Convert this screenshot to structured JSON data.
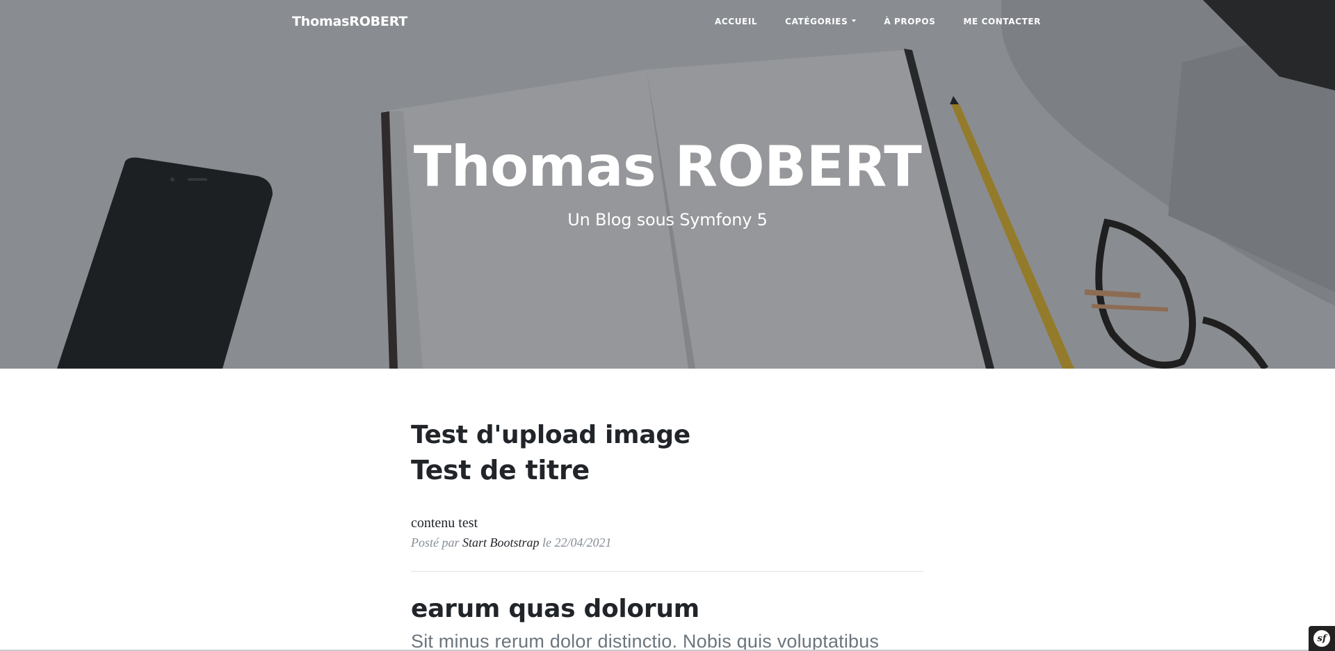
{
  "navbar": {
    "brand": "ThomasROBERT",
    "links": [
      {
        "label": "Accueil"
      },
      {
        "label": "Catégories",
        "dropdown": true
      },
      {
        "label": "À propos"
      },
      {
        "label": "Me contacter"
      }
    ]
  },
  "hero": {
    "title": "Thomas ROBERT",
    "subtitle": "Un Blog sous Symfony 5"
  },
  "posts": [
    {
      "title": "Test d'upload image",
      "subtitle": "Test de titre",
      "excerpt": "contenu test",
      "meta_prefix": "Posté par",
      "author": "Start Bootstrap",
      "meta_date_prefix": "le",
      "date": "22/04/2021"
    },
    {
      "title": "earum quas dolorum",
      "excerpt": "Sit minus rerum dolor distinctio. Nobis quis voluptatibus"
    }
  ],
  "toolbar": {
    "icon": "symfony-logo-icon",
    "glyph": "sf"
  },
  "colors": {
    "overlay": "#212529",
    "text": "#212529",
    "meta": "#868e96"
  }
}
